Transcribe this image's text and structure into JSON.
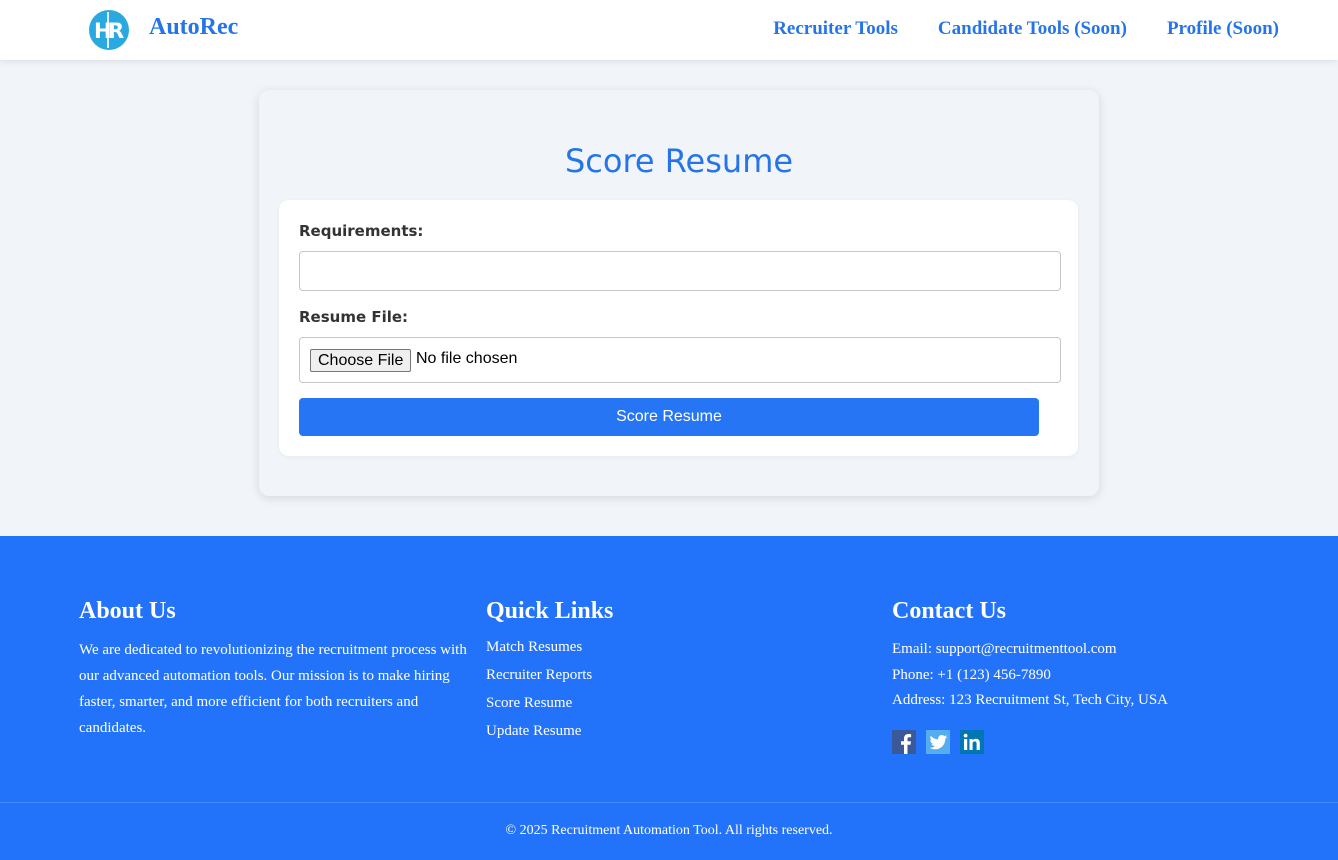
{
  "header": {
    "brand": "AutoRec",
    "logo_text": "HR",
    "nav": [
      {
        "label": "Recruiter Tools"
      },
      {
        "label": "Candidate Tools (Soon)"
      },
      {
        "label": "Profile (Soon)"
      }
    ]
  },
  "main": {
    "title": "Score Resume",
    "requirements_label": "Requirements:",
    "requirements_value": "",
    "resume_label": "Resume File:",
    "choose_file_label": "Choose File",
    "file_status": "No file chosen",
    "submit_label": "Score Resume"
  },
  "footer": {
    "about": {
      "title": "About Us",
      "text": "We are dedicated to revolutionizing the recruitment process with our advanced automation tools. Our mission is to make hiring faster, smarter, and more efficient for both recruiters and candidates."
    },
    "quick_links": {
      "title": "Quick Links",
      "items": [
        "Match Resumes",
        "Recruiter Reports",
        "Score Resume",
        "Update Resume"
      ]
    },
    "contact": {
      "title": "Contact Us",
      "email": "Email: support@recruitmenttool.com",
      "phone": "Phone: +1 (123) 456-7890",
      "address": "Address: 123 Recruitment St, Tech City, USA",
      "socials": [
        "facebook-icon",
        "twitter-icon",
        "linkedin-icon"
      ]
    },
    "copyright": "© 2025 Recruitment Automation Tool. All rights reserved."
  },
  "colors": {
    "accent": "#2575e8",
    "footer_bg": "#2372fa",
    "button_bg": "#2575f5",
    "page_bg": "#f1f5f9"
  }
}
